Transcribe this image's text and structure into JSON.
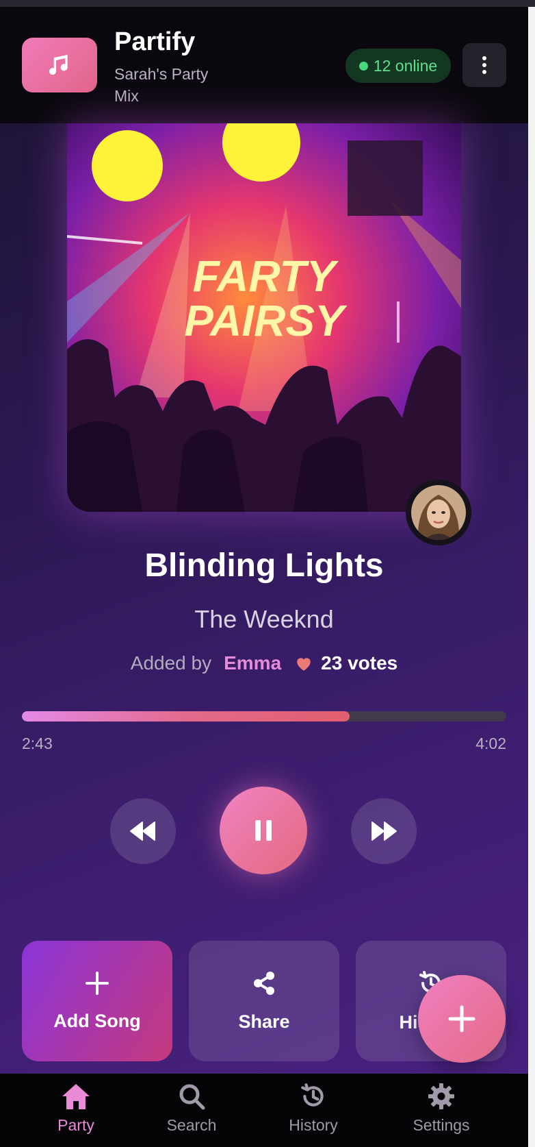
{
  "header": {
    "app_name": "Partify",
    "party_name": "Sarah's Party Mix",
    "online_count": "12 online",
    "logo_icon": "music-note-icon",
    "menu_icon": "more-vertical-icon"
  },
  "now_playing": {
    "album_art_text_line1": "FARTY",
    "album_art_text_line2": "PAIRSY",
    "title": "Blinding Lights",
    "artist": "The Weeknd",
    "added_by_label": "Added by",
    "added_by_name": "Emma",
    "votes": "23 votes",
    "elapsed": "2:43",
    "duration": "4:02",
    "progress_fraction": 0.677
  },
  "controls": {
    "prev_icon": "rewind-icon",
    "play_pause_icon": "pause-icon",
    "next_icon": "fast-forward-icon"
  },
  "actions": [
    {
      "label": "Add Song",
      "icon": "plus-icon"
    },
    {
      "label": "Share",
      "icon": "share-icon"
    },
    {
      "label": "History",
      "icon": "history-icon"
    }
  ],
  "fab": {
    "icon": "plus-icon"
  },
  "nav": [
    {
      "label": "Party",
      "icon": "home-icon",
      "active": true
    },
    {
      "label": "Search",
      "icon": "search-icon",
      "active": false
    },
    {
      "label": "History",
      "icon": "history-icon",
      "active": false
    },
    {
      "label": "Settings",
      "icon": "gear-icon",
      "active": false
    }
  ],
  "colors": {
    "accent_pink": "#f07ab9",
    "accent_purple": "#8b35d9",
    "online_green": "#49d77e",
    "nav_active": "#e98bd7"
  }
}
